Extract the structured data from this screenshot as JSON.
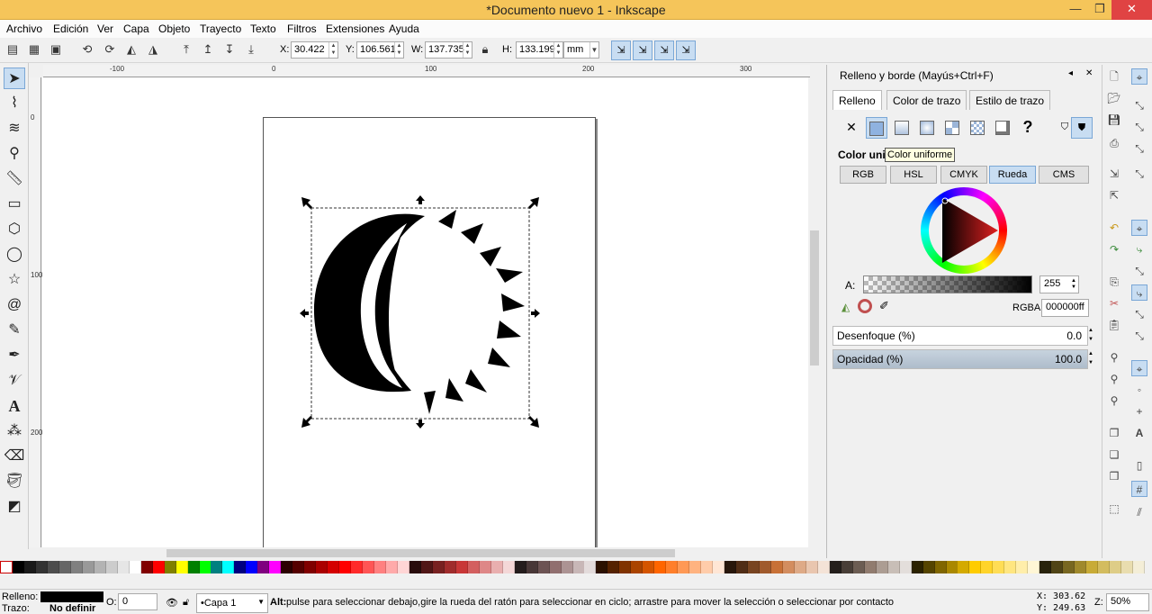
{
  "window": {
    "title": "*Documento nuevo 1 - Inkscape",
    "minimize": "—",
    "maximize": "❐",
    "close": "✕"
  },
  "menu": [
    "Archivo",
    "Edición",
    "Ver",
    "Capa",
    "Objeto",
    "Trayecto",
    "Texto",
    "Filtros",
    "Extensiones",
    "Ayuda"
  ],
  "toolbar": {
    "x_label": "X:",
    "x_value": "30.422",
    "y_label": "Y:",
    "y_value": "106.561",
    "w_label": "W:",
    "w_value": "137.735",
    "h_label": "H:",
    "h_value": "133.199",
    "unit": "mm"
  },
  "ruler": {
    "h_ticks": [
      "-100",
      "0",
      "100",
      "200",
      "300"
    ],
    "v_ticks": [
      "0",
      "100",
      "200"
    ]
  },
  "dock": {
    "title": "Relleno y borde (Mayús+Ctrl+F)",
    "tabs": [
      "Relleno",
      "Color de trazo",
      "Estilo de trazo"
    ],
    "fill_label": "Color unif",
    "tooltip": "Color uniforme",
    "unset_glyph": "✕",
    "unknown_glyph": "?",
    "modes": [
      "RGB",
      "HSL",
      "CMYK",
      "Rueda",
      "CMS"
    ],
    "alpha_label": "A:",
    "alpha_value": "255",
    "rgba_label": "RGBA:",
    "rgba_value": "000000ff",
    "blur_label": "Desenfoque (%)",
    "blur_value": "0.0",
    "opacity_label": "Opacidad (%)",
    "opacity_value": "100.0"
  },
  "status": {
    "fill_label": "Relleno:",
    "stroke_label": "Trazo:",
    "stroke_value": "No definir",
    "opacity_label": "O:",
    "opacity_value": "0",
    "layer": "•Capa 1",
    "message_strong": "Alt:",
    "message": " pulse para seleccionar debajo,gire la rueda del ratón para seleccionar en ciclo; arrastre para mover la selección o seleccionar por contacto",
    "x_coord": "X:  303.62",
    "y_coord": "Y:  249.63",
    "zoom_label": "Z:",
    "zoom_value": "50%"
  },
  "colors": {
    "accent": "#c8ddf2",
    "titlebar": "#f5c55a",
    "close": "#e04343"
  }
}
